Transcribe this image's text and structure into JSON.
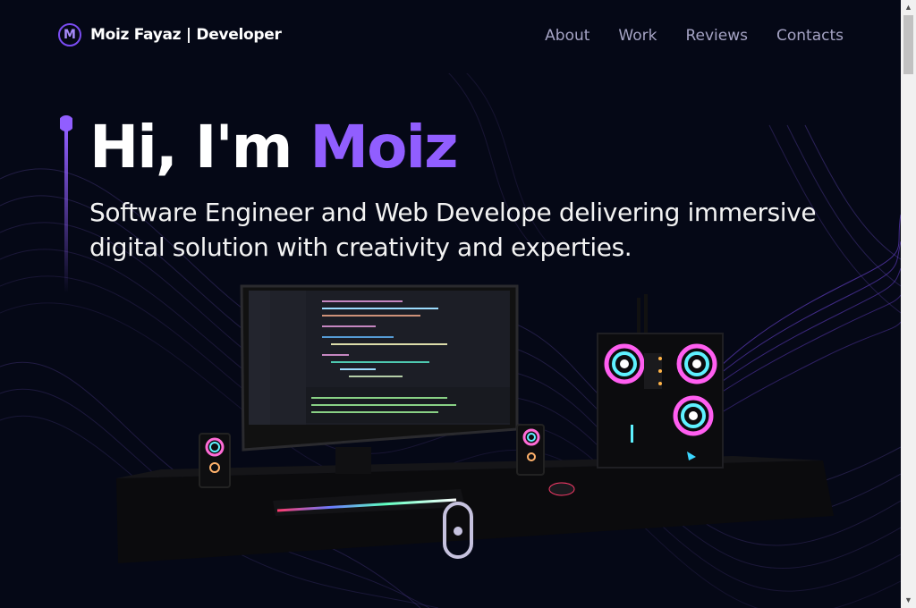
{
  "nav": {
    "logo_letter": "M",
    "brand": "Moiz Fayaz | Developer",
    "links": [
      "About",
      "Work",
      "Reviews",
      "Contacts"
    ]
  },
  "hero": {
    "greeting": "Hi, I'm ",
    "name": "Moiz",
    "subtitle": "Software Engineer and Web Develope delivering immersive digital solution with creativity and experties."
  },
  "scene": {
    "description_icon": "desk-setup-3d-model"
  },
  "colors": {
    "background": "#050816",
    "accent": "#915eff",
    "nav_link": "#a5a3c4"
  },
  "icons": {
    "scroll_hint": "mouse-scroll-icon"
  }
}
